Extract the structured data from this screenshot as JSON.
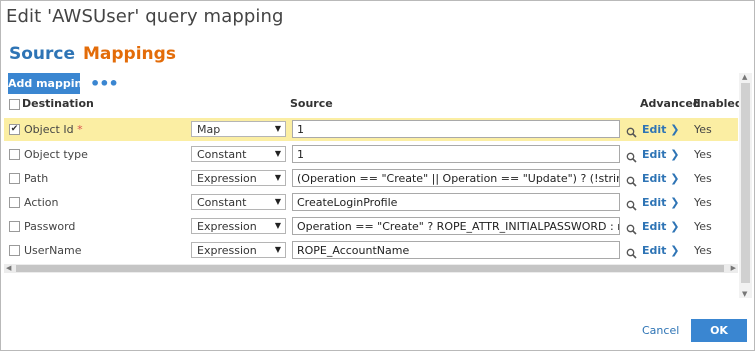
{
  "dialog": {
    "title": "Edit 'AWSUser' query mapping"
  },
  "tabs": {
    "source": "Source",
    "mappings": "Mappings"
  },
  "toolbar": {
    "add_mapping": "Add mapping",
    "more": "•••"
  },
  "columns": {
    "destination": "Destination",
    "source": "Source",
    "advanced": "Advanced",
    "enabled": "Enabled"
  },
  "rows": [
    {
      "checked": true,
      "destination": "Object Id",
      "required": "*",
      "type": "Map",
      "source": "1",
      "edit": "Edit",
      "enabled": "Yes"
    },
    {
      "checked": false,
      "destination": "Object type",
      "required": "",
      "type": "Constant",
      "source": "1",
      "edit": "Edit",
      "enabled": "Yes"
    },
    {
      "checked": false,
      "destination": "Path",
      "required": "",
      "type": "Expression",
      "source": "(Operation == \"Create\" || Operation == \"Update\") ? (!string.Is",
      "edit": "Edit",
      "enabled": "Yes"
    },
    {
      "checked": false,
      "destination": "Action",
      "required": "",
      "type": "Constant",
      "source": "CreateLoginProfile",
      "edit": "Edit",
      "enabled": "Yes"
    },
    {
      "checked": false,
      "destination": "Password",
      "required": "",
      "type": "Expression",
      "source": "Operation == \"Create\" ? ROPE_ATTR_INITIALPASSWORD : null",
      "edit": "Edit",
      "enabled": "Yes"
    },
    {
      "checked": false,
      "destination": "UserName",
      "required": "",
      "type": "Expression",
      "source": "ROPE_AccountName",
      "edit": "Edit",
      "enabled": "Yes"
    }
  ],
  "footer": {
    "cancel": "Cancel",
    "ok": "OK"
  },
  "colors": {
    "accent_blue": "#2e74b5",
    "accent_orange": "#e36c09",
    "selected_row": "#fbeea3",
    "button_blue": "#3a86d1"
  }
}
